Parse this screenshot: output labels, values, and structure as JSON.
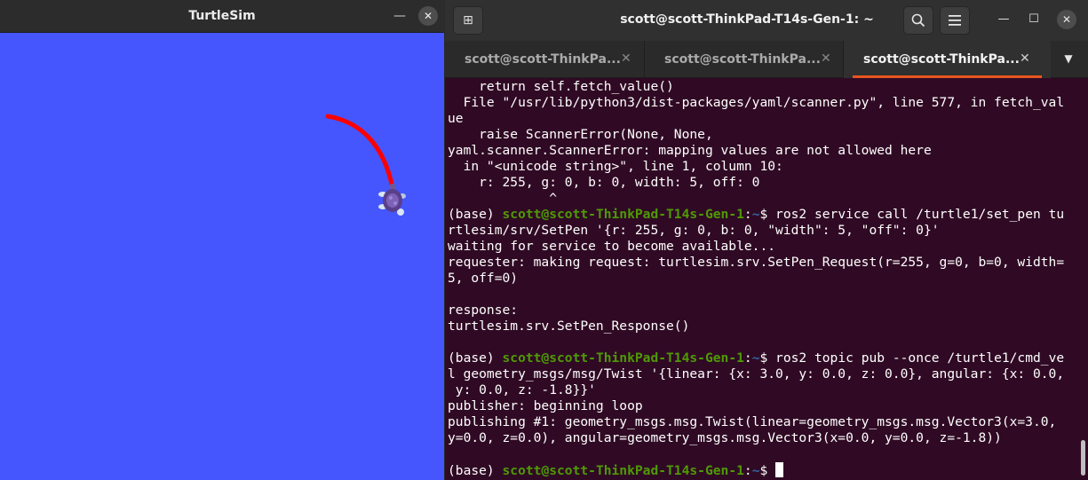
{
  "turtlesim": {
    "title": "TurtleSim",
    "minimize_glyph": "—",
    "close_glyph": "✕",
    "background_color": "#4556ff",
    "pen_color": "#ff0000"
  },
  "terminal": {
    "title": "scott@scott-ThinkPad-T14s-Gen-1: ~",
    "new_tab_glyph": "⊞",
    "search_icon": "search-icon",
    "menu_icon": "hamburger-menu-icon",
    "minimize_glyph": "—",
    "maximize_glyph": "☐",
    "close_glyph": "✕",
    "tabs": [
      {
        "label": "scott@scott-ThinkPa...",
        "close": "✕"
      },
      {
        "label": "scott@scott-ThinkPa...",
        "close": "✕"
      },
      {
        "label": "scott@scott-ThinkPa...",
        "close": "✕"
      }
    ],
    "tab_overflow_glyph": "▼",
    "colors": {
      "background": "#300a24",
      "prompt_user": "#4e9a06",
      "prompt_path": "#3465a4",
      "active_tab_accent": "#e95420"
    },
    "lines": [
      {
        "text": "    return self.fetch_value()"
      },
      {
        "text": "  File \"/usr/lib/python3/dist-packages/yaml/scanner.py\", line 577, in fetch_val"
      },
      {
        "text": "ue"
      },
      {
        "text": "    raise ScannerError(None, None,"
      },
      {
        "text": "yaml.scanner.ScannerError: mapping values are not allowed here"
      },
      {
        "text": "  in \"<unicode string>\", line 1, column 10:"
      },
      {
        "text": "    r: 255, g: 0, b: 0, width: 5, off: 0"
      },
      {
        "text": "             ^"
      },
      {
        "prefix": "(base) ",
        "user": "scott@scott-ThinkPad-T14s-Gen-1",
        "sep": ":",
        "path": "~",
        "text": "$ ros2 service call /turtle1/set_pen tu"
      },
      {
        "text": "rtlesim/srv/SetPen '{r: 255, g: 0, b: 0, \"width\": 5, \"off\": 0}'"
      },
      {
        "text": "waiting for service to become available..."
      },
      {
        "text": "requester: making request: turtlesim.srv.SetPen_Request(r=255, g=0, b=0, width="
      },
      {
        "text": "5, off=0)"
      },
      {
        "text": ""
      },
      {
        "text": "response:"
      },
      {
        "text": "turtlesim.srv.SetPen_Response()"
      },
      {
        "text": ""
      },
      {
        "prefix": "(base) ",
        "user": "scott@scott-ThinkPad-T14s-Gen-1",
        "sep": ":",
        "path": "~",
        "text": "$ ros2 topic pub --once /turtle1/cmd_ve"
      },
      {
        "text": "l geometry_msgs/msg/Twist '{linear: {x: 3.0, y: 0.0, z: 0.0}, angular: {x: 0.0,"
      },
      {
        "text": " y: 0.0, z: -1.8}}'"
      },
      {
        "text": "publisher: beginning loop"
      },
      {
        "text": "publishing #1: geometry_msgs.msg.Twist(linear=geometry_msgs.msg.Vector3(x=3.0,"
      },
      {
        "text": "y=0.0, z=0.0), angular=geometry_msgs.msg.Vector3(x=0.0, y=0.0, z=-1.8))"
      },
      {
        "text": ""
      },
      {
        "prefix": "(base) ",
        "user": "scott@scott-ThinkPad-T14s-Gen-1",
        "sep": ":",
        "path": "~",
        "text": "$ ",
        "cursor": true
      }
    ]
  }
}
